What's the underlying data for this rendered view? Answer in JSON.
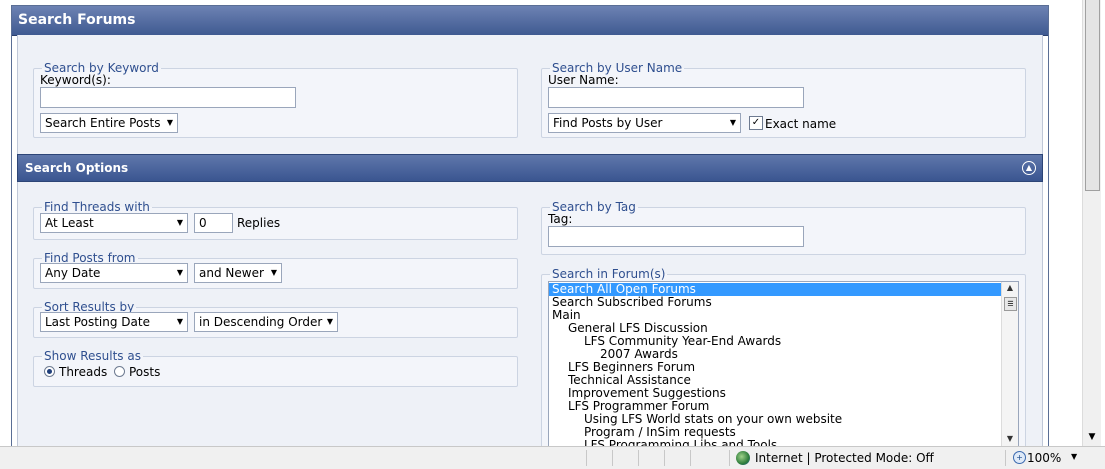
{
  "page_title": "Search Forums",
  "keyword_section": {
    "legend": "Search by Keyword",
    "label": "Keyword(s):",
    "value": "",
    "scope_select": "Search Entire Posts"
  },
  "username_section": {
    "legend": "Search by User Name",
    "label": "User Name:",
    "value": "",
    "find_select": "Find Posts by User",
    "exact_checked": true,
    "exact_label": "Exact name"
  },
  "options_header": "Search Options",
  "threads_section": {
    "legend": "Find Threads with",
    "select": "At Least",
    "count": "0",
    "suffix": "Replies"
  },
  "posts_from_section": {
    "legend": "Find Posts from",
    "date_select": "Any Date",
    "direction_select": "and Newer"
  },
  "sort_section": {
    "legend": "Sort Results by",
    "field_select": "Last Posting Date",
    "order_select": "in Descending Order"
  },
  "show_results_section": {
    "legend": "Show Results as",
    "options": [
      "Threads",
      "Posts"
    ],
    "selected": "Threads"
  },
  "tag_section": {
    "legend": "Search by Tag",
    "label": "Tag:",
    "value": ""
  },
  "forum_section": {
    "legend": "Search in Forum(s)",
    "items": [
      {
        "label": "Search All Open Forums",
        "indent": 0,
        "selected": true
      },
      {
        "label": "Search Subscribed Forums",
        "indent": 0,
        "selected": false
      },
      {
        "label": "Main",
        "indent": 0,
        "selected": false
      },
      {
        "label": "General LFS Discussion",
        "indent": 1,
        "selected": false
      },
      {
        "label": "LFS Community Year-End Awards",
        "indent": 2,
        "selected": false
      },
      {
        "label": "2007 Awards",
        "indent": 3,
        "selected": false
      },
      {
        "label": "LFS Beginners Forum",
        "indent": 1,
        "selected": false
      },
      {
        "label": "Technical Assistance",
        "indent": 1,
        "selected": false
      },
      {
        "label": "Improvement Suggestions",
        "indent": 1,
        "selected": false
      },
      {
        "label": "LFS Programmer Forum",
        "indent": 1,
        "selected": false
      },
      {
        "label": "Using LFS World stats on your own website",
        "indent": 2,
        "selected": false
      },
      {
        "label": "Program / InSim requests",
        "indent": 2,
        "selected": false
      },
      {
        "label": "LFS Programming Libs and Tools",
        "indent": 2,
        "selected": false
      }
    ]
  },
  "statusbar": {
    "zone": "Internet | Protected Mode: Off",
    "zoom": "100%"
  },
  "icons": {
    "collapse": "collapse-up-icon",
    "dropdown": "chevron-down-icon",
    "globe": "globe-icon",
    "zoom": "zoom-icon"
  },
  "colors": {
    "header_bg": "#4a6499",
    "legend_text": "#2f4f8f",
    "selection": "#3399ff"
  }
}
